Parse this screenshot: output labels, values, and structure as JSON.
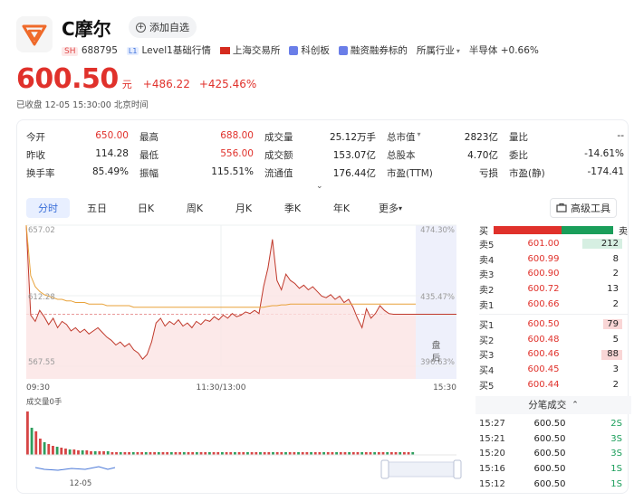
{
  "stock": {
    "name": "C摩尔",
    "add_favorite": "添加自选",
    "market_tag": "SH",
    "code": "688795",
    "level_tag": "L1",
    "level": "Level1基础行情",
    "exchange": "上海交易所",
    "board": "科创板",
    "margin": "融资融券标的",
    "industry_label": "所属行业",
    "industry": "半导体 +0.66%"
  },
  "quote": {
    "price": "600.50",
    "unit": "元",
    "change": "+486.22",
    "change_pct": "+425.46%",
    "status": "已收盘  12-05 15:30:00 北京时间"
  },
  "stats": [
    [
      {
        "k": "今开",
        "v": "650.00",
        "c": "red"
      },
      {
        "k": "最高",
        "v": "688.00",
        "c": "red"
      },
      {
        "k": "成交量",
        "v": "25.12万手"
      },
      {
        "k": "总市值",
        "v": "2823亿",
        "caret": true
      },
      {
        "k": "量比",
        "v": "--"
      }
    ],
    [
      {
        "k": "昨收",
        "v": "114.28"
      },
      {
        "k": "最低",
        "v": "556.00",
        "c": "red"
      },
      {
        "k": "成交额",
        "v": "153.07亿"
      },
      {
        "k": "总股本",
        "v": "4.70亿"
      },
      {
        "k": "委比",
        "v": "-14.61%"
      }
    ],
    [
      {
        "k": "换手率",
        "v": "85.49%"
      },
      {
        "k": "振幅",
        "v": "115.51%"
      },
      {
        "k": "流通值",
        "v": "176.44亿"
      },
      {
        "k": "市盈(TTM)",
        "v": "亏损"
      },
      {
        "k": "市盈(静)",
        "v": "-174.41"
      }
    ]
  ],
  "tabs": [
    "分时",
    "五日",
    "日K",
    "周K",
    "月K",
    "季K",
    "年K",
    "更多"
  ],
  "advanced_tools": "高级工具",
  "chart_data": {
    "type": "line",
    "y_left_ticks": [
      "657.02",
      "612.28",
      "567.55"
    ],
    "y_right_ticks": [
      "474.30%",
      "435.47%",
      "396.63%"
    ],
    "x_ticks": [
      "09:30",
      "11:30/13:00",
      "15:30"
    ],
    "after_hours_label": "盘后",
    "volume_label": "成交量0手",
    "mini_x_label": "12-05",
    "ylim": [
      567.55,
      657.02
    ],
    "prev_close_pct_line": 600.5,
    "price_series": [
      657,
      600,
      596,
      603,
      599,
      594,
      598,
      592,
      596,
      594,
      590,
      592,
      589,
      591,
      588,
      590,
      592,
      589,
      586,
      584,
      581,
      583,
      580,
      582,
      578,
      576,
      572,
      575,
      583,
      595,
      598,
      593,
      596,
      594,
      597,
      593,
      595,
      592,
      596,
      594,
      597,
      596,
      599,
      597,
      600,
      598,
      601,
      599,
      600,
      602,
      601,
      603,
      601,
      618,
      630,
      648,
      622,
      616,
      626,
      622,
      620,
      617,
      619,
      616,
      618,
      615,
      612,
      611,
      613,
      610,
      612,
      608,
      610,
      605,
      598,
      592,
      604,
      598,
      601,
      606,
      603,
      601,
      600.5,
      600.5,
      600.5,
      600.5,
      600.5,
      600.5
    ],
    "avg_series": [
      657,
      625,
      618,
      615,
      613,
      612,
      611,
      610,
      610,
      609,
      609,
      608,
      608,
      608,
      607,
      607,
      607,
      607,
      606,
      606,
      606,
      606,
      606,
      606,
      605,
      605,
      605,
      605,
      605,
      605,
      605,
      605,
      605,
      605,
      605,
      605,
      605,
      605,
      605,
      605,
      605,
      605,
      605,
      605,
      605,
      605,
      605,
      605,
      605,
      605,
      605,
      605,
      605,
      605,
      605.5,
      606,
      606,
      606.5,
      606.5,
      607,
      607,
      607,
      607,
      607,
      607,
      607,
      607,
      607,
      607,
      607,
      607,
      607,
      607,
      607,
      607,
      607,
      607,
      607,
      607,
      607,
      607,
      607,
      607,
      607,
      607,
      607,
      607,
      607
    ]
  },
  "orderbook": {
    "buy_label": "买",
    "sell_label": "卖",
    "sell_ratio": 0.43,
    "asks": [
      {
        "label": "卖5",
        "price": "601.00",
        "qty": "212",
        "bar": 0.95
      },
      {
        "label": "卖4",
        "price": "600.99",
        "qty": "8",
        "bar": 0
      },
      {
        "label": "卖3",
        "price": "600.90",
        "qty": "2",
        "bar": 0
      },
      {
        "label": "卖2",
        "price": "600.72",
        "qty": "13",
        "bar": 0
      },
      {
        "label": "卖1",
        "price": "600.66",
        "qty": "2",
        "bar": 0
      }
    ],
    "bids": [
      {
        "label": "买1",
        "price": "600.50",
        "qty": "79",
        "bar": 0.45
      },
      {
        "label": "买2",
        "price": "600.48",
        "qty": "5",
        "bar": 0
      },
      {
        "label": "买3",
        "price": "600.46",
        "qty": "88",
        "bar": 0.5
      },
      {
        "label": "买4",
        "price": "600.45",
        "qty": "3",
        "bar": 0
      },
      {
        "label": "买5",
        "price": "600.44",
        "qty": "2",
        "bar": 0
      }
    ],
    "ticks_title": "分笔成交",
    "ticks": [
      {
        "t": "15:27",
        "p": "600.50",
        "v": "2S"
      },
      {
        "t": "15:21",
        "p": "600.50",
        "v": "3S"
      },
      {
        "t": "15:20",
        "p": "600.50",
        "v": "3S"
      },
      {
        "t": "15:16",
        "p": "600.50",
        "v": "1S"
      },
      {
        "t": "15:12",
        "p": "600.50",
        "v": "1S"
      }
    ]
  },
  "colors": {
    "up": "#e0312b",
    "down": "#1a9e5a",
    "avg": "#e8a23a",
    "accent": "#3b6fd9"
  }
}
